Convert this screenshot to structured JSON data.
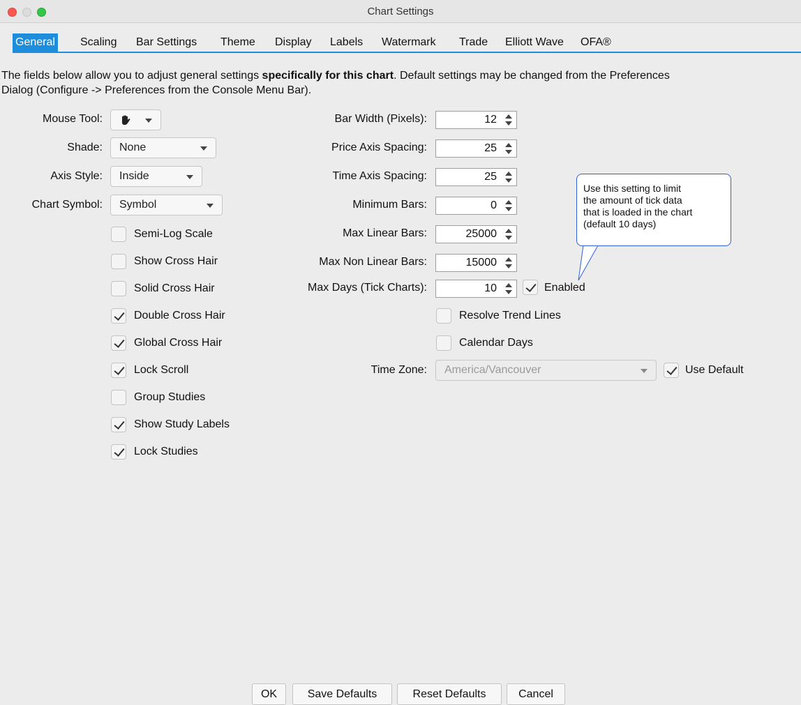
{
  "window": {
    "title": "Chart Settings"
  },
  "tabs": [
    "General",
    "Scaling",
    "Bar Settings",
    "Theme",
    "Display",
    "Labels",
    "Watermark",
    "Trade",
    "Elliott Wave",
    "OFA®"
  ],
  "description": {
    "part1": "The fields below allow you to adjust general settings ",
    "bold": "specifically for this chart",
    "part2": ".  Default settings may be changed from the Preferences",
    "line2": "Dialog (Configure -> Preferences from the Console Menu Bar)."
  },
  "left": {
    "mouse_tool_label": "Mouse Tool:",
    "mouse_tool_icon": "hand-icon",
    "shade_label": "Shade:",
    "shade_value": "None",
    "axis_style_label": "Axis Style:",
    "axis_style_value": "Inside",
    "chart_symbol_label": "Chart Symbol:",
    "chart_symbol_value": "Symbol",
    "checkboxes": [
      {
        "label": "Semi-Log Scale",
        "checked": false
      },
      {
        "label": "Show Cross Hair",
        "checked": false
      },
      {
        "label": "Solid Cross Hair",
        "checked": false
      },
      {
        "label": "Double Cross Hair",
        "checked": true
      },
      {
        "label": "Global Cross Hair",
        "checked": true
      },
      {
        "label": "Lock Scroll",
        "checked": true
      },
      {
        "label": "Group Studies",
        "checked": false
      },
      {
        "label": "Show Study Labels",
        "checked": true
      },
      {
        "label": "Lock Studies",
        "checked": true
      }
    ]
  },
  "right": {
    "fields": [
      {
        "label": "Bar Width (Pixels):",
        "value": "12"
      },
      {
        "label": "Price Axis Spacing:",
        "value": "25"
      },
      {
        "label": "Time Axis Spacing:",
        "value": "25"
      },
      {
        "label": "Minimum Bars:",
        "value": "0"
      },
      {
        "label": "Max Linear Bars:",
        "value": "25000"
      },
      {
        "label": "Max Non Linear Bars:",
        "value": "15000"
      },
      {
        "label": "Max Days (Tick Charts):",
        "value": "10"
      }
    ],
    "enabled_label": "Enabled",
    "enabled_checked": true,
    "resolve_trend_lines_label": "Resolve Trend Lines",
    "resolve_trend_lines_checked": false,
    "calendar_days_label": "Calendar Days",
    "calendar_days_checked": false,
    "time_zone_label": "Time Zone:",
    "time_zone_value": "America/Vancouver",
    "use_default_label": "Use Default",
    "use_default_checked": true
  },
  "callout": {
    "lines": [
      "Use this setting to limit",
      "the amount of tick data",
      "that is loaded in the chart",
      "(default 10 days)"
    ]
  },
  "buttons": {
    "ok": "OK",
    "save_defaults": "Save Defaults",
    "reset_defaults": "Reset Defaults",
    "cancel": "Cancel"
  },
  "colors": {
    "accent": "#1d8ddc",
    "callout_border": "#2f5fd6"
  }
}
